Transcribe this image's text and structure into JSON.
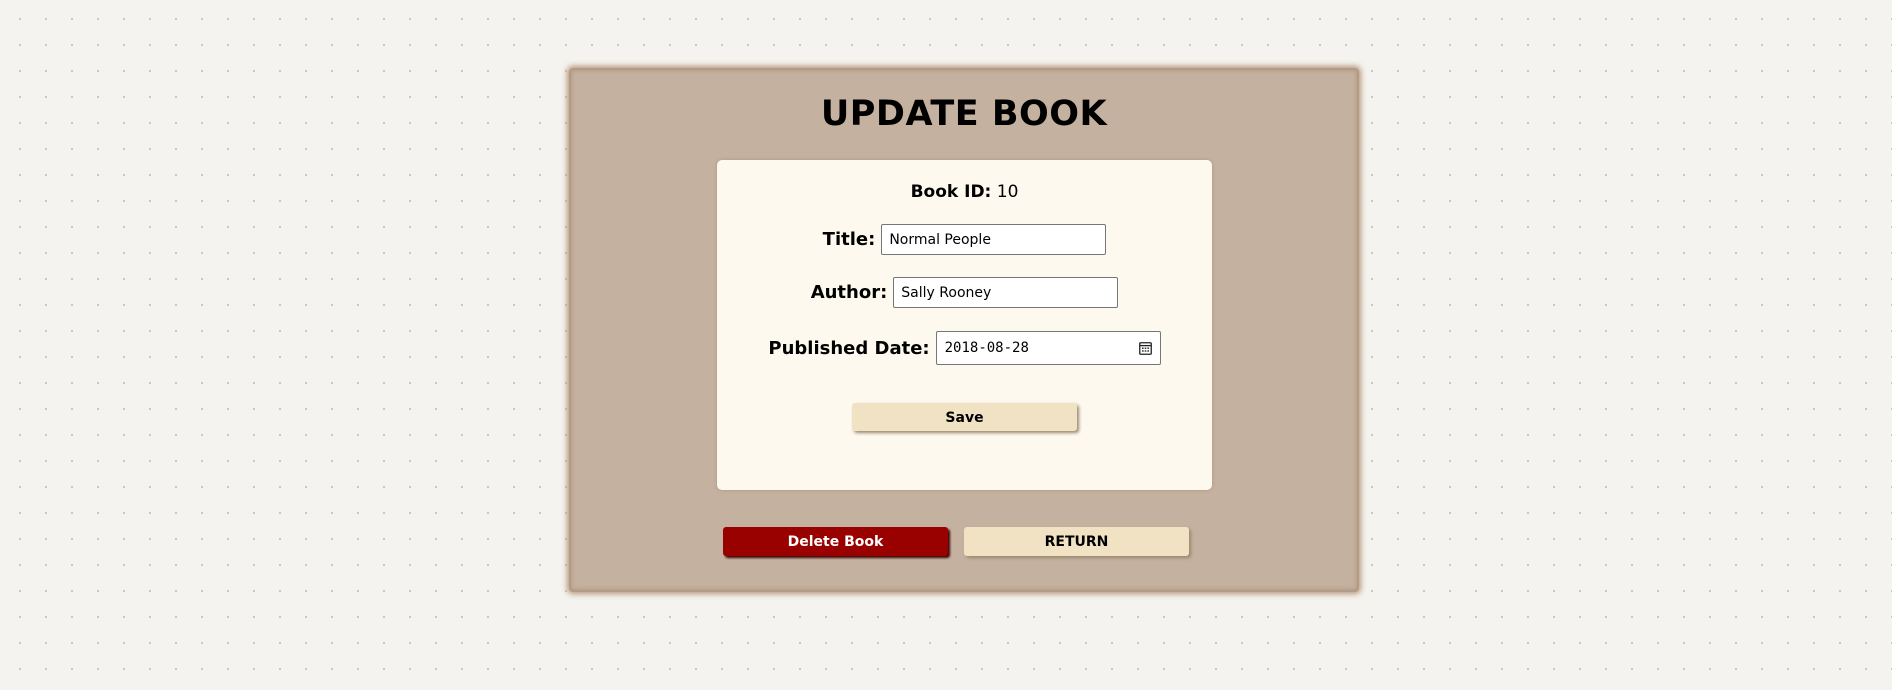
{
  "page": {
    "title": "UPDATE BOOK"
  },
  "book": {
    "id_label": "Book ID:",
    "id_value": "10"
  },
  "form": {
    "title_label": "Title:",
    "title_value": "Normal People",
    "author_label": "Author:",
    "author_value": "Sally Rooney",
    "date_label": "Published Date:",
    "date_value": "2018-08-28",
    "date_icon": "calendar-icon",
    "save_label": "Save"
  },
  "actions": {
    "delete_label": "Delete Book",
    "return_label": "RETURN"
  },
  "colors": {
    "background": "#f4f3ef",
    "panel": "#c5b19f",
    "card": "#fef9ee",
    "button_cream": "#f1e2c3",
    "button_delete": "#990000"
  }
}
